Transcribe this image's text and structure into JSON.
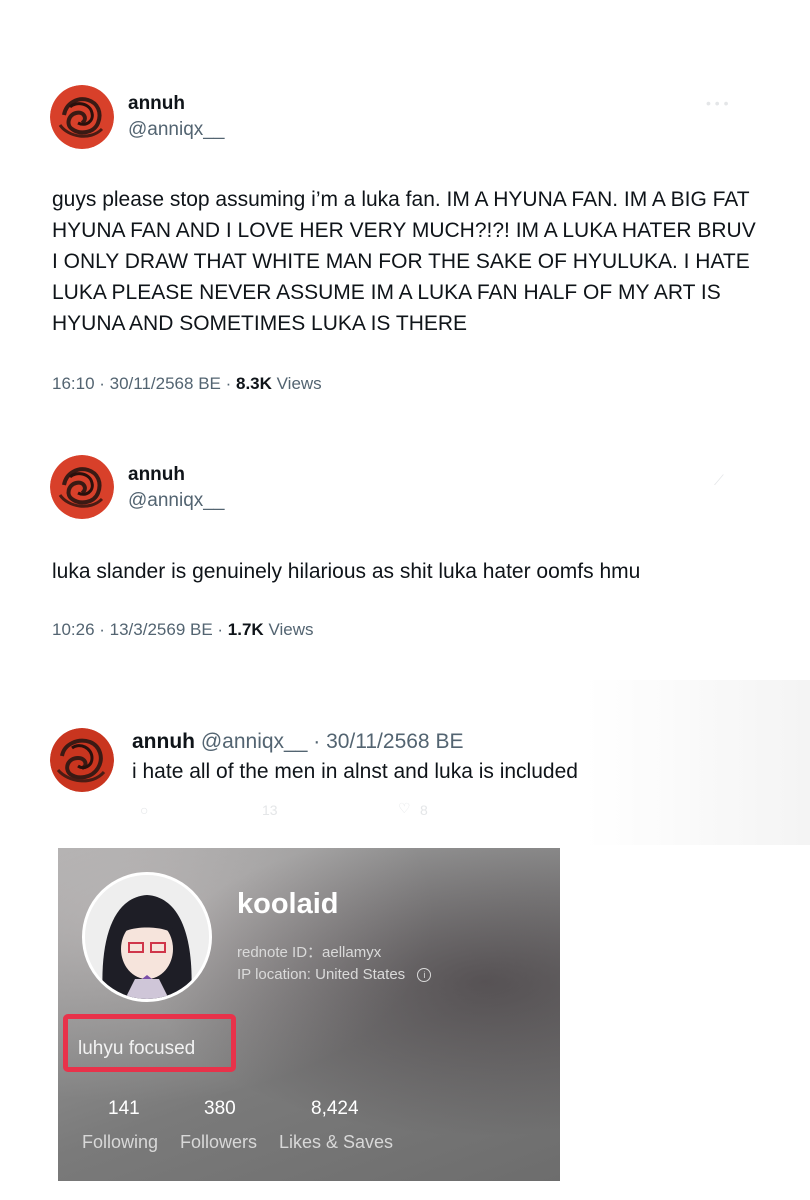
{
  "tweets": [
    {
      "name": "annuh",
      "handle": "@anniqx__",
      "text": "guys please stop assuming i’m a luka fan. IM A HYUNA FAN. IM A BIG FAT HYUNA FAN AND I LOVE HER VERY MUCH?!?! IM A LUKA HATER BRUV I ONLY DRAW THAT WHITE MAN FOR THE SAKE OF HYULUKA. I HATE LUKA PLEASE NEVER ASSUME IM A LUKA FAN HALF OF MY ART IS HYUNA AND SOMETIMES LUKA IS THERE",
      "time_date": "16:10 · 30/11/2568 BE · ",
      "views_count": "8.3K",
      "views_label": " Views"
    },
    {
      "name": "annuh",
      "handle": "@anniqx__",
      "text": "luka slander is genuinely hilarious as shit luka hater oomfs hmu",
      "time_date": "10:26 · 13/3/2569 BE · ",
      "views_count": "1.7K",
      "views_label": " Views"
    }
  ],
  "reply_tweet": {
    "name": "annuh",
    "handle_date": "@anniqx__ · 30/11/2568 BE",
    "text": "i hate all of the men in alnst and luka is included",
    "faint_counts": [
      "13",
      "8"
    ]
  },
  "rednote_profile": {
    "name": "koolaid",
    "id_line": "rednote ID：aellamyx",
    "ip_line": "IP location: United States",
    "info_icon": "info-circle-icon",
    "bio": "luhyu focused",
    "highlight_color": "#e8324a",
    "stats": [
      {
        "value": "141",
        "label": "Following"
      },
      {
        "value": "380",
        "label": "Followers"
      },
      {
        "value": "8,424",
        "label": "Likes & Saves"
      }
    ]
  },
  "colors": {
    "text_primary": "#0f1419",
    "text_secondary": "#536471",
    "avatar_red": "#d8402a"
  }
}
